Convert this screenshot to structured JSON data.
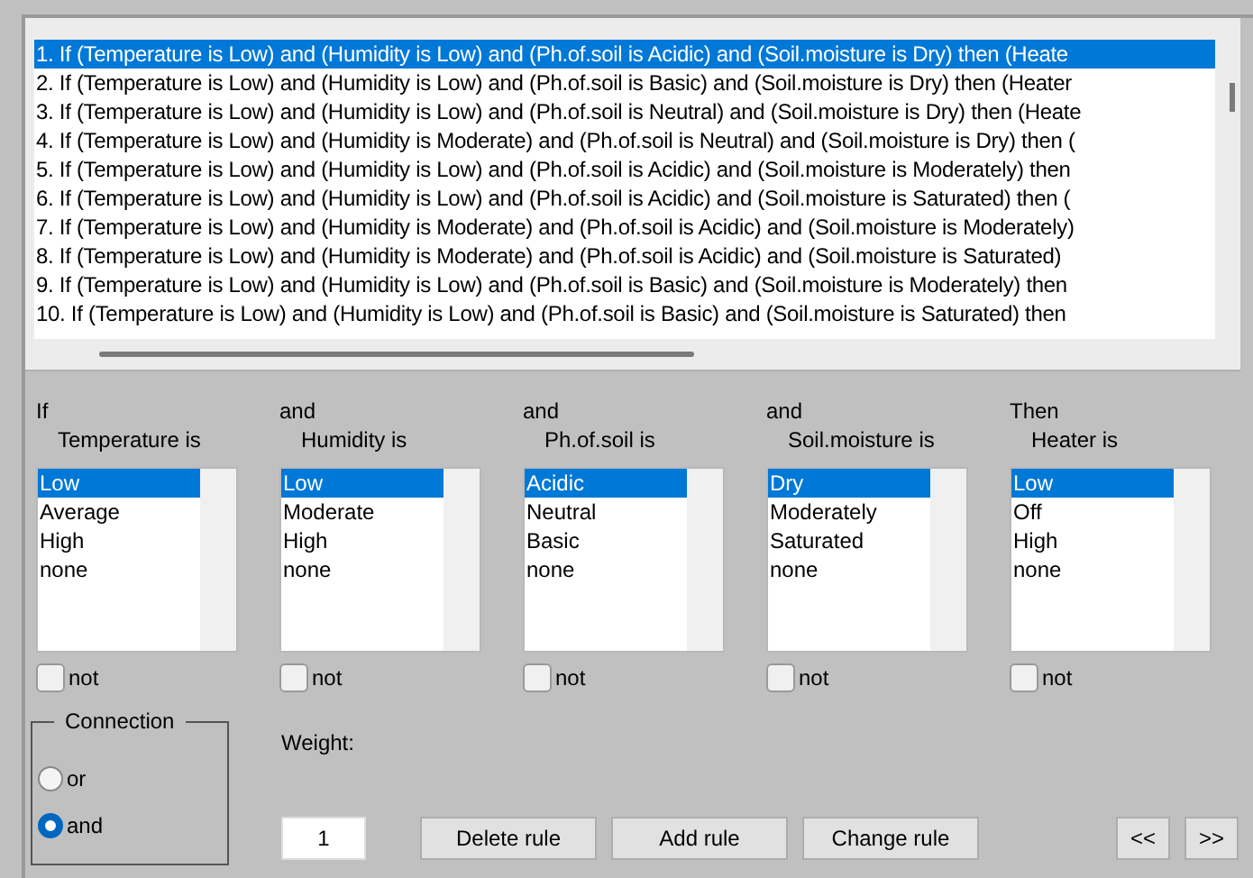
{
  "rules": [
    {
      "text": "1. If (Temperature is Low) and (Humidity is Low) and (Ph.of.soil is Acidic) and (Soil.moisture is Dry) then (Heate",
      "selected": true
    },
    {
      "text": "2. If (Temperature is Low) and (Humidity is Low) and (Ph.of.soil is Basic) and (Soil.moisture is Dry) then (Heater",
      "selected": false
    },
    {
      "text": "3. If (Temperature is Low) and (Humidity is Low) and (Ph.of.soil is Neutral) and (Soil.moisture is Dry) then (Heate",
      "selected": false
    },
    {
      "text": "4. If (Temperature is Low) and (Humidity is Moderate) and (Ph.of.soil is Neutral) and (Soil.moisture is Dry) then (",
      "selected": false
    },
    {
      "text": "5. If (Temperature is Low) and (Humidity is Low) and (Ph.of.soil is Acidic) and (Soil.moisture is Moderately) then",
      "selected": false
    },
    {
      "text": "6. If (Temperature is Low) and (Humidity is Low) and (Ph.of.soil is Acidic) and (Soil.moisture is Saturated) then (",
      "selected": false
    },
    {
      "text": "7. If (Temperature is Low) and (Humidity is Moderate) and (Ph.of.soil is Acidic) and (Soil.moisture is Moderately)",
      "selected": false
    },
    {
      "text": "8. If (Temperature is Low) and (Humidity is Moderate) and (Ph.of.soil is Acidic) and (Soil.moisture is Saturated)",
      "selected": false
    },
    {
      "text": "9. If (Temperature is Low) and (Humidity is Low) and (Ph.of.soil is Basic) and (Soil.moisture is Moderately) then",
      "selected": false
    },
    {
      "text": "10. If (Temperature is Low) and (Humidity is Low) and (Ph.of.soil is Basic) and (Soil.moisture is Saturated) then",
      "selected": false
    }
  ],
  "columns": [
    {
      "connector": "If",
      "label": "Temperature is",
      "options": [
        {
          "label": "Low",
          "selected": true
        },
        {
          "label": "Average",
          "selected": false
        },
        {
          "label": "High",
          "selected": false
        },
        {
          "label": "none",
          "selected": false
        }
      ],
      "not": {
        "label": "not",
        "checked": false
      }
    },
    {
      "connector": "and",
      "label": "Humidity is",
      "options": [
        {
          "label": "Low",
          "selected": true
        },
        {
          "label": "Moderate",
          "selected": false
        },
        {
          "label": "High",
          "selected": false
        },
        {
          "label": "none",
          "selected": false
        }
      ],
      "not": {
        "label": "not",
        "checked": false
      }
    },
    {
      "connector": "and",
      "label": "Ph.of.soil is",
      "options": [
        {
          "label": "Acidic",
          "selected": true
        },
        {
          "label": "Neutral",
          "selected": false
        },
        {
          "label": "Basic",
          "selected": false
        },
        {
          "label": "none",
          "selected": false
        }
      ],
      "not": {
        "label": "not",
        "checked": false
      }
    },
    {
      "connector": "and",
      "label": "Soil.moisture is",
      "options": [
        {
          "label": "Dry",
          "selected": true
        },
        {
          "label": "Moderately",
          "selected": false
        },
        {
          "label": "Saturated",
          "selected": false
        },
        {
          "label": "none",
          "selected": false
        }
      ],
      "not": {
        "label": "not",
        "checked": false
      }
    },
    {
      "connector": "Then",
      "label": "Heater is",
      "options": [
        {
          "label": "Low",
          "selected": true
        },
        {
          "label": "Off",
          "selected": false
        },
        {
          "label": "High",
          "selected": false
        },
        {
          "label": "none",
          "selected": false
        }
      ],
      "not": {
        "label": "not",
        "checked": false
      }
    }
  ],
  "connection": {
    "title": "Connection",
    "options": [
      {
        "label": "or",
        "selected": false
      },
      {
        "label": "and",
        "selected": true
      }
    ]
  },
  "weight": {
    "label": "Weight:",
    "value": "1"
  },
  "buttons": [
    "Delete rule",
    "Add rule",
    "Change rule"
  ],
  "nav_buttons": [
    "<<",
    ">>"
  ]
}
